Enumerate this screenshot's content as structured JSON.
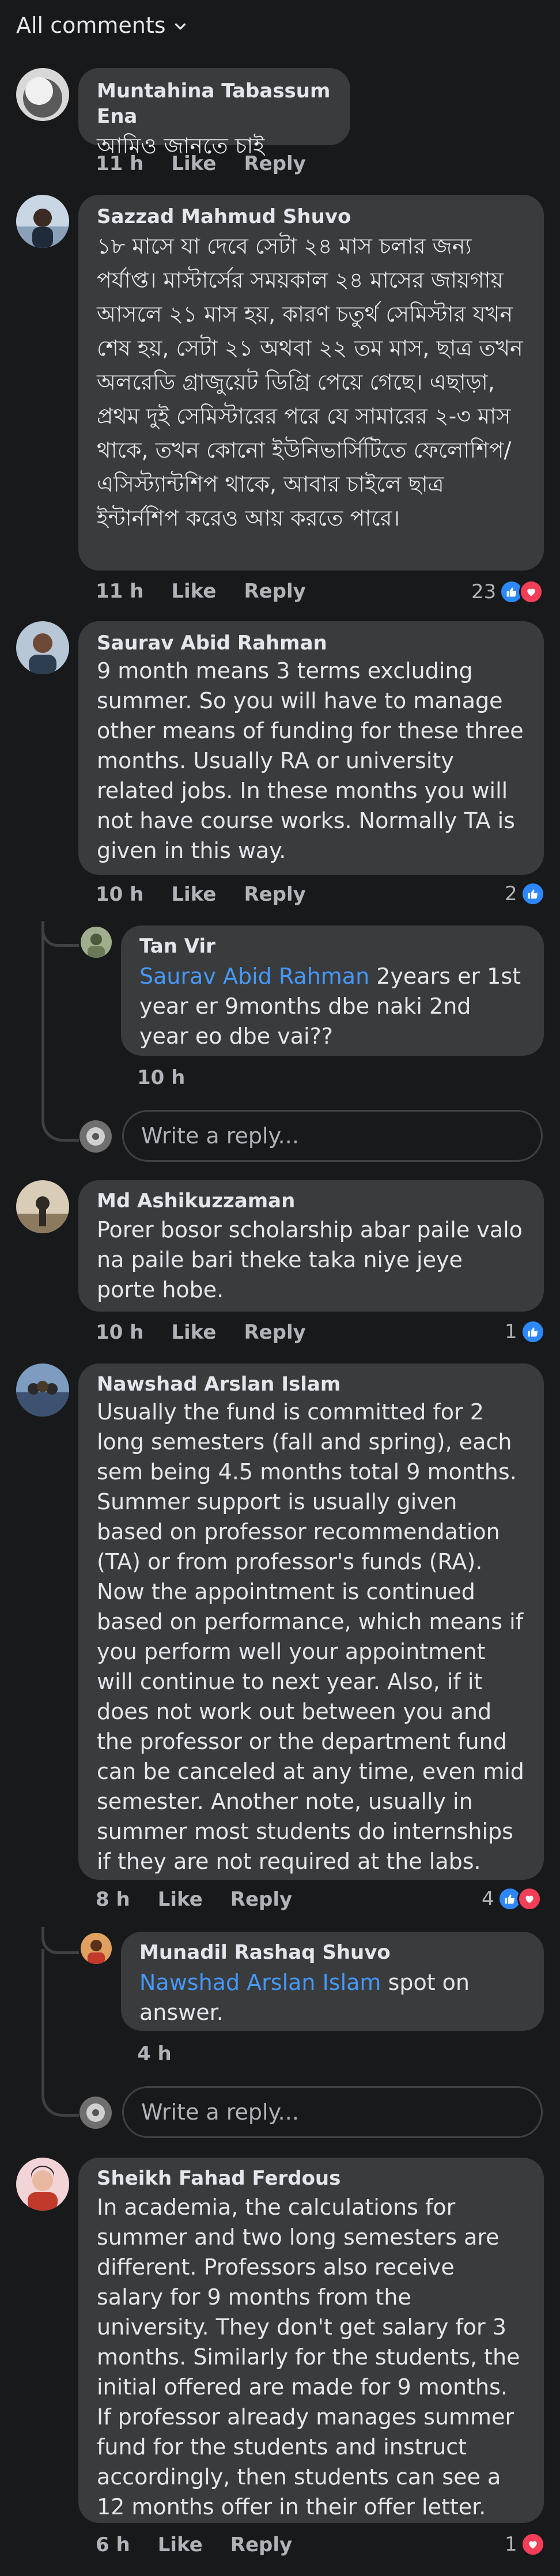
{
  "filter": {
    "label": "All comments",
    "icon": "chevron-down-icon"
  },
  "reply_placeholder": "Write a reply...",
  "comments": [
    {
      "author": "Muntahina Tabassum Ena",
      "text": "আমিও জানতে চাই",
      "time": "11 h",
      "like_label": "Like",
      "reply_label": "Reply"
    },
    {
      "author": "Sazzad Mahmud Shuvo",
      "text": "১৮ মাসে যা দেবে সেটা ২৪ মাস চলার জন্য পর্যাপ্ত। মাস্টার্সের সময়কাল ২৪ মাসের জায়গায় আসলে ২১ মাস হয়, কারণ চতুর্থ সেমিস্টার যখন শেষ হয়, সেটা ২১ অথবা ২২ তম মাস, ছাত্র তখন অলরেডি গ্রাজুয়েট ডিগ্রি পেয়ে গেছে। এছাড়া, প্রথম দুই সেমিস্টারের পরে যে সামারের ২-৩ মাস থাকে, তখন কোনো ইউনিভার্সিটিতে ফেলোশিপ/এসিস্ট্যান্টশিপ থাকে, আবার চাইলে ছাত্র ইন্টার্নশিপ করেও আয় করতে পারে।",
      "time": "11 h",
      "like_label": "Like",
      "reply_label": "Reply",
      "reaction_count": "23"
    },
    {
      "author": "Saurav Abid Rahman",
      "text": "9 month means 3 terms excluding summer. So you will have to manage other means of funding for these three months. Usually RA or university related jobs. In these months you will not have course works. Normally TA is given in this way.",
      "time": "10 h",
      "like_label": "Like",
      "reply_label": "Reply",
      "reaction_count": "2",
      "replies": [
        {
          "author": "Tan Vir",
          "mention": "Saurav Abid Rahman",
          "text": " 2years er 1st year er 9months dbe naki 2nd year eo dbe vai??",
          "time": "10 h"
        }
      ]
    },
    {
      "author": "Md Ashikuzzaman",
      "text": "Porer bosor scholarship abar paile valo na paile bari theke taka niye jeye porte hobe.",
      "time": "10 h",
      "like_label": "Like",
      "reply_label": "Reply",
      "reaction_count": "1"
    },
    {
      "author": "Nawshad Arslan Islam",
      "text": "Usually the fund is committed for 2 long semesters (fall and spring), each sem being 4.5 months total 9 months. Summer support is usually given based on professor recommendation (TA) or from professor's funds (RA). Now the appointment is continued based on performance, which means if you perform well your appointment will continue to next year. Also, if it does not work out between you and the professor or the department fund can be canceled at any time, even mid semester. Another note, usually in summer most students do internships if they are not required at the labs.",
      "time": "8 h",
      "like_label": "Like",
      "reply_label": "Reply",
      "reaction_count": "4",
      "replies": [
        {
          "author": "Munadil Rashaq Shuvo",
          "mention": "Nawshad Arslan Islam",
          "text": " spot on answer.",
          "time": "4 h"
        }
      ]
    },
    {
      "author": "Sheikh Fahad Ferdous",
      "text": "In academia, the calculations for summer and two long semesters are different. Professors also receive salary for 9 months from the university. They don't get salary for 3 months. Similarly for the students, the initial offered are made for 9 months. If professor already manages summer fund for the students and instruct accordingly, then students can see a 12 months offer in their offer letter.",
      "time": "6 h",
      "like_label": "Like",
      "reply_label": "Reply",
      "reaction_count": "1"
    }
  ],
  "colors": {
    "background": "#18191a",
    "bubble": "#3a3b3c",
    "text": "#e4e6eb",
    "muted": "#b0b3b8",
    "link": "#4599ff",
    "like": "#2d88ff",
    "love": "#f33e58"
  }
}
